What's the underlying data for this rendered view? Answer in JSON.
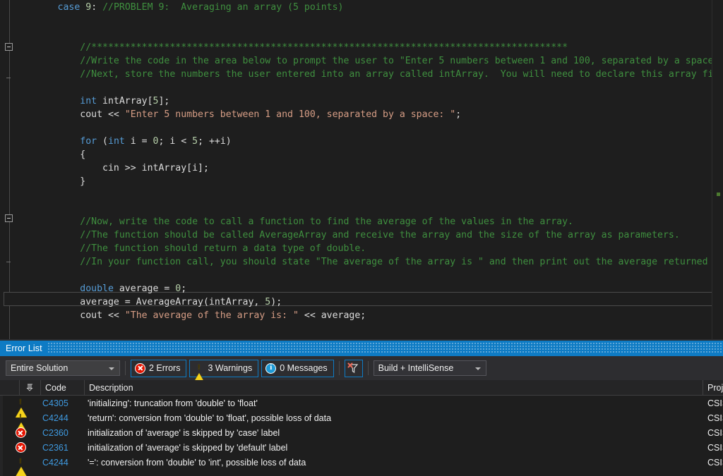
{
  "editor": {
    "language": "cpp",
    "current_line_text": "        double average = 0;",
    "lines": [
      {
        "indent": 8,
        "tokens": [
          {
            "t": "case",
            "c": "kw"
          },
          {
            "t": " ",
            "c": "plain"
          },
          {
            "t": "9",
            "c": "num"
          },
          {
            "t": ": ",
            "c": "plain"
          },
          {
            "t": "//PROBLEM 9:  Averaging an array (5 points)",
            "c": "cmt"
          }
        ]
      },
      {
        "indent": 0,
        "tokens": []
      },
      {
        "indent": 0,
        "tokens": []
      },
      {
        "indent": 12,
        "tokens": [
          {
            "t": "//*************************************************************************************",
            "c": "cmt"
          }
        ]
      },
      {
        "indent": 12,
        "tokens": [
          {
            "t": "//Write the code in the area below to prompt the user to \"Enter 5 numbers between 1 and 100, separated by a space:\"",
            "c": "cmt"
          }
        ]
      },
      {
        "indent": 12,
        "tokens": [
          {
            "t": "//Next, store the numbers the user entered into an array called intArray.  You will need to declare this array first.",
            "c": "cmt"
          }
        ]
      },
      {
        "indent": 0,
        "tokens": []
      },
      {
        "indent": 12,
        "tokens": [
          {
            "t": "int",
            "c": "kw"
          },
          {
            "t": " intArray[",
            "c": "plain"
          },
          {
            "t": "5",
            "c": "num"
          },
          {
            "t": "];",
            "c": "plain"
          }
        ]
      },
      {
        "indent": 12,
        "tokens": [
          {
            "t": "cout << ",
            "c": "plain"
          },
          {
            "t": "\"Enter 5 numbers between 1 and 100, separated by a space: \"",
            "c": "str"
          },
          {
            "t": ";",
            "c": "plain"
          }
        ]
      },
      {
        "indent": 0,
        "tokens": []
      },
      {
        "indent": 12,
        "tokens": [
          {
            "t": "for",
            "c": "kw"
          },
          {
            "t": " (",
            "c": "plain"
          },
          {
            "t": "int",
            "c": "kw"
          },
          {
            "t": " i = ",
            "c": "plain"
          },
          {
            "t": "0",
            "c": "num"
          },
          {
            "t": "; i < ",
            "c": "plain"
          },
          {
            "t": "5",
            "c": "num"
          },
          {
            "t": "; ++i)",
            "c": "plain"
          }
        ]
      },
      {
        "indent": 12,
        "tokens": [
          {
            "t": "{",
            "c": "plain"
          }
        ]
      },
      {
        "indent": 16,
        "tokens": [
          {
            "t": "cin >> intArray[i];",
            "c": "plain"
          }
        ]
      },
      {
        "indent": 12,
        "tokens": [
          {
            "t": "}",
            "c": "plain"
          }
        ]
      },
      {
        "indent": 0,
        "tokens": []
      },
      {
        "indent": 0,
        "tokens": []
      },
      {
        "indent": 12,
        "tokens": [
          {
            "t": "//Now, write the code to call a function to find the average of the values in the array.",
            "c": "cmt"
          }
        ]
      },
      {
        "indent": 12,
        "tokens": [
          {
            "t": "//The function should be called AverageArray and receive the array and the size of the array as parameters.",
            "c": "cmt"
          }
        ]
      },
      {
        "indent": 12,
        "tokens": [
          {
            "t": "//The function should return a data type of double.",
            "c": "cmt"
          }
        ]
      },
      {
        "indent": 12,
        "tokens": [
          {
            "t": "//In your function call, you should state \"The average of the array is \" and then print out the average returned by the",
            "c": "cmt"
          }
        ]
      },
      {
        "indent": 0,
        "tokens": []
      },
      {
        "indent": 12,
        "tokens": [
          {
            "t": "double",
            "c": "kw"
          },
          {
            "t": " average = ",
            "c": "plain"
          },
          {
            "t": "0",
            "c": "num"
          },
          {
            "t": ";",
            "c": "plain"
          }
        ]
      },
      {
        "indent": 12,
        "tokens": [
          {
            "t": "average = AverageArray(intArray, ",
            "c": "plain"
          },
          {
            "t": "5",
            "c": "num"
          },
          {
            "t": ");",
            "c": "plain"
          }
        ]
      },
      {
        "indent": 12,
        "tokens": [
          {
            "t": "cout << ",
            "c": "plain"
          },
          {
            "t": "\"The average of the array is: \"",
            "c": "str"
          },
          {
            "t": " << average;",
            "c": "plain"
          }
        ]
      }
    ]
  },
  "error_list": {
    "title": "Error List",
    "toolbar": {
      "scope_value": "Entire Solution",
      "errors_label": "2 Errors",
      "errors_count": 2,
      "warnings_label": "3 Warnings",
      "warnings_count": 3,
      "messages_label": "0 Messages",
      "messages_count": 0,
      "filter_icon": "clear-filter-icon",
      "build_value": "Build + IntelliSense"
    },
    "columns": {
      "pin": "",
      "code": "Code",
      "description": "Description",
      "project": "Proj"
    },
    "rows": [
      {
        "severity": "warning",
        "code": "C4305",
        "description": "'initializing': truncation from 'double' to 'float'",
        "project": "CSIS_"
      },
      {
        "severity": "warning",
        "code": "C4244",
        "description": "'return': conversion from 'double' to 'float', possible loss of data",
        "project": "CSIS_"
      },
      {
        "severity": "error",
        "code": "C2360",
        "description": "initialization of 'average' is skipped by 'case' label",
        "project": "CSIS"
      },
      {
        "severity": "error",
        "code": "C2361",
        "description": "initialization of 'average' is skipped by 'default' label",
        "project": "CSIS"
      },
      {
        "severity": "warning",
        "code": "C4244",
        "description": "'=': conversion from 'double' to 'int', possible loss of data",
        "project": "CSIS"
      }
    ]
  },
  "colors": {
    "editor_bg": "#1e1e1e",
    "panel_bg": "#252526",
    "toolbar_bg": "#2d2d30",
    "title_blue": "#0e7bc4",
    "accent_blue": "#3f9ae0",
    "error_red": "#e51400",
    "warning_yellow": "#f6d31b",
    "info_blue": "#1e9ad6",
    "keyword": "#569cd6",
    "comment": "#3f8f3f",
    "string": "#d69d85",
    "number": "#b5cea8",
    "text": "#dcdcdc"
  }
}
